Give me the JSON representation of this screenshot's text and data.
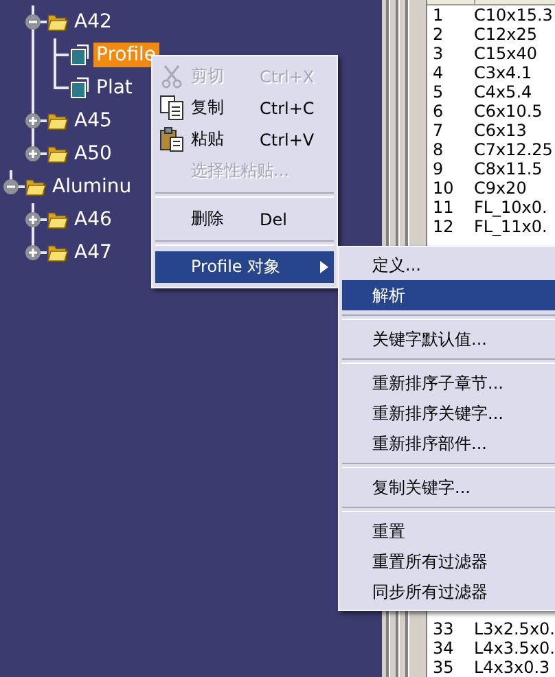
{
  "tree": {
    "items": [
      {
        "children": [
          {
            "label": "A42",
            "expanded": true,
            "children": [
              {
                "label": "Profile",
                "selected": true
              },
              {
                "label": "Plat",
                "selected": false
              }
            ]
          },
          {
            "label": "A45",
            "expanded": false
          },
          {
            "label": "A50",
            "expanded": false
          }
        ]
      },
      {
        "label": "Aluminu",
        "expanded": true,
        "children": [
          {
            "label": "A46",
            "expanded": false
          },
          {
            "label": "A47",
            "expanded": false
          }
        ]
      }
    ]
  },
  "table": {
    "rows_top": [
      {
        "number": "1",
        "name": "C10x15.3"
      },
      {
        "number": "2",
        "name": "C12x25"
      },
      {
        "number": "3",
        "name": "C15x40"
      },
      {
        "number": "4",
        "name": "C3x4.1"
      },
      {
        "number": "5",
        "name": "C4x5.4"
      },
      {
        "number": "6",
        "name": "C6x10.5"
      },
      {
        "number": "7",
        "name": "C6x13"
      },
      {
        "number": "8",
        "name": "C7x12.25"
      },
      {
        "number": "9",
        "name": "C8x11.5"
      },
      {
        "number": "10",
        "name": "C9x20"
      },
      {
        "number": "11",
        "name": "FL_10x0."
      },
      {
        "number": "12",
        "name": "FL_11x0."
      }
    ],
    "rows_bottom": [
      {
        "number": "33",
        "name": "L3x2.5x0."
      },
      {
        "number": "34",
        "name": "L4x3.5x0."
      },
      {
        "number": "35",
        "name": "L4x3x0.3"
      }
    ]
  },
  "context_menu": {
    "items": [
      {
        "kind": "item",
        "label": "剪切",
        "shortcut": "Ctrl+X",
        "disabled": true,
        "selected": false
      },
      {
        "kind": "item",
        "label": "复制",
        "shortcut": "Ctrl+C",
        "disabled": false,
        "selected": false
      },
      {
        "kind": "item",
        "label": "粘贴",
        "shortcut": "Ctrl+V",
        "disabled": false,
        "selected": false
      },
      {
        "kind": "item",
        "label": "选择性粘贴...",
        "disabled": true,
        "selected": false
      },
      {
        "kind": "separator"
      },
      {
        "kind": "item",
        "label": "删除",
        "shortcut": "Del",
        "disabled": false,
        "selected": false
      },
      {
        "kind": "separator"
      },
      {
        "kind": "submenu",
        "label": "Profile 对象",
        "disabled": false,
        "selected": true
      }
    ]
  },
  "submenu": {
    "items": [
      {
        "kind": "item",
        "label": "定义...",
        "selected": false
      },
      {
        "kind": "item",
        "label": "解析",
        "selected": true
      },
      {
        "kind": "separator"
      },
      {
        "kind": "item",
        "label": "关键字默认值...",
        "selected": false
      },
      {
        "kind": "separator"
      },
      {
        "kind": "item",
        "label": "重新排序子章节...",
        "selected": false
      },
      {
        "kind": "item",
        "label": "重新排序关键字...",
        "selected": false
      },
      {
        "kind": "item",
        "label": "重新排序部件...",
        "selected": false
      },
      {
        "kind": "separator"
      },
      {
        "kind": "item",
        "label": "复制关键字...",
        "selected": false
      },
      {
        "kind": "separator"
      },
      {
        "kind": "item",
        "label": "重置",
        "selected": false
      },
      {
        "kind": "item",
        "label": "重置所有过滤器",
        "selected": false
      },
      {
        "kind": "item",
        "label": "同步所有过滤器",
        "selected": false
      }
    ]
  }
}
